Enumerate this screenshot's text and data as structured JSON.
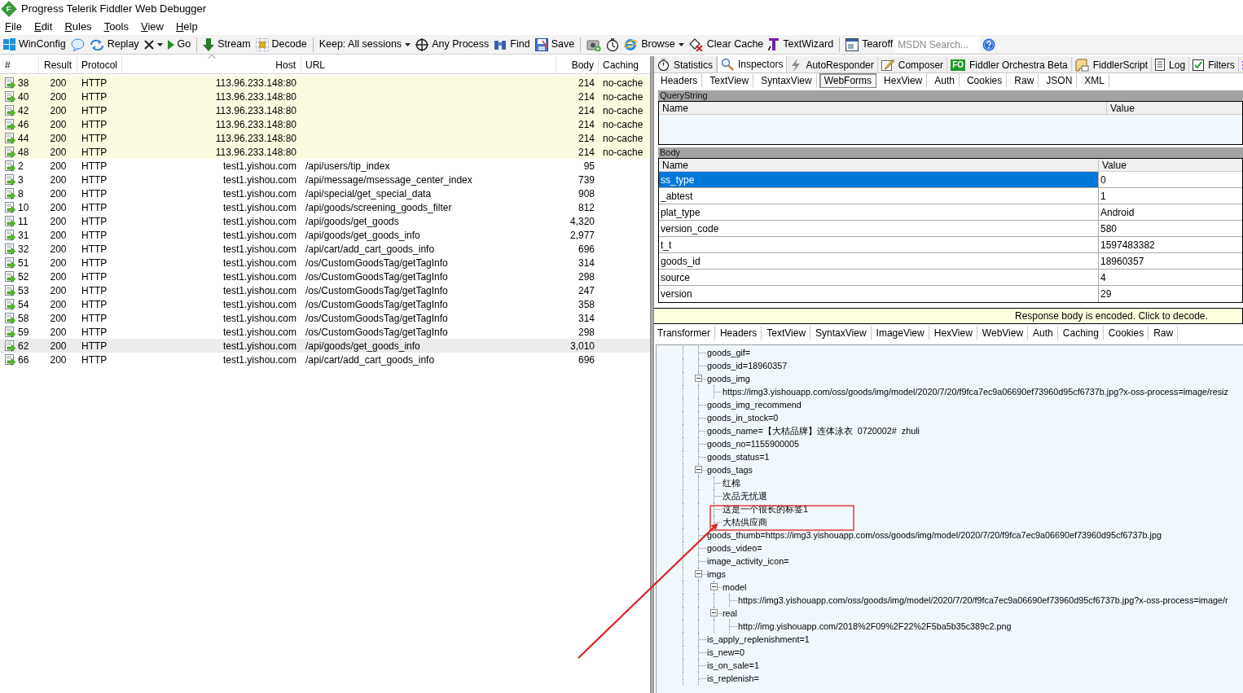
{
  "window": {
    "logo_text": "F",
    "title": "Progress Telerik Fiddler Web Debugger"
  },
  "menu": [
    "File",
    "Edit",
    "Rules",
    "Tools",
    "View",
    "Help"
  ],
  "toolbar": [
    {
      "kind": "button",
      "label": "WinConfig"
    },
    {
      "kind": "button"
    },
    {
      "kind": "button",
      "label": "Replay"
    },
    {
      "kind": "button",
      "dropdown": true
    },
    {
      "kind": "button",
      "label": "Go"
    },
    {
      "kind": "separator"
    },
    {
      "kind": "button",
      "label": "Stream"
    },
    {
      "kind": "button",
      "label": "Decode"
    },
    {
      "kind": "separator"
    },
    {
      "kind": "button",
      "label": "Keep: All sessions",
      "dropdown": true
    },
    {
      "kind": "button",
      "label": "Any Process"
    },
    {
      "kind": "button",
      "label": "Find"
    },
    {
      "kind": "button",
      "label": "Save"
    },
    {
      "kind": "separator"
    },
    {
      "kind": "button"
    },
    {
      "kind": "button"
    },
    {
      "kind": "button",
      "label": "Browse",
      "dropdown": true
    },
    {
      "kind": "button",
      "label": "Clear Cache"
    },
    {
      "kind": "button",
      "label": "TextWizard"
    },
    {
      "kind": "separator"
    },
    {
      "kind": "button",
      "label": "Tearoff"
    },
    {
      "kind": "search",
      "placeholder": "MSDN Search..."
    },
    {
      "kind": "button"
    }
  ],
  "sessions": {
    "columns": [
      {
        "label": "#",
        "sorted": false
      },
      {
        "label": "Result",
        "sorted": false
      },
      {
        "label": "Protocol",
        "sorted": false
      },
      {
        "label": "Host",
        "sorted": true
      },
      {
        "label": "URL",
        "sorted": false
      },
      {
        "label": "Body",
        "sorted": false
      },
      {
        "label": "Caching",
        "sorted": false
      }
    ],
    "rows": [
      {
        "id": "38",
        "result": "200",
        "protocol": "HTTP",
        "host": "113.96.233.148:80",
        "body": "214",
        "caching": "no-cache",
        "kind": "tunnel",
        "selected": false
      },
      {
        "id": "40",
        "result": "200",
        "protocol": "HTTP",
        "host": "113.96.233.148:80",
        "body": "214",
        "caching": "no-cache",
        "kind": "tunnel",
        "selected": false
      },
      {
        "id": "42",
        "result": "200",
        "protocol": "HTTP",
        "host": "113.96.233.148:80",
        "body": "214",
        "caching": "no-cache",
        "kind": "tunnel",
        "selected": false
      },
      {
        "id": "46",
        "result": "200",
        "protocol": "HTTP",
        "host": "113.96.233.148:80",
        "body": "214",
        "caching": "no-cache",
        "kind": "tunnel",
        "selected": false
      },
      {
        "id": "44",
        "result": "200",
        "protocol": "HTTP",
        "host": "113.96.233.148:80",
        "body": "214",
        "caching": "no-cache",
        "kind": "tunnel",
        "selected": false
      },
      {
        "id": "48",
        "result": "200",
        "protocol": "HTTP",
        "host": "113.96.233.148:80",
        "body": "214",
        "caching": "no-cache",
        "kind": "tunnel",
        "selected": false
      },
      {
        "id": "2",
        "result": "200",
        "protocol": "HTTP",
        "host": "test1.yishou.com",
        "url": "/api/users/tip_index",
        "body": "95",
        "kind": "request",
        "selected": false
      },
      {
        "id": "3",
        "result": "200",
        "protocol": "HTTP",
        "host": "test1.yishou.com",
        "url": "/api/message/msessage_center_index",
        "body": "739",
        "kind": "request",
        "selected": false
      },
      {
        "id": "8",
        "result": "200",
        "protocol": "HTTP",
        "host": "test1.yishou.com",
        "url": "/api/special/get_special_data",
        "body": "908",
        "kind": "request",
        "selected": false
      },
      {
        "id": "10",
        "result": "200",
        "protocol": "HTTP",
        "host": "test1.yishou.com",
        "url": "/api/goods/screening_goods_filter",
        "body": "812",
        "kind": "request",
        "selected": false
      },
      {
        "id": "11",
        "result": "200",
        "protocol": "HTTP",
        "host": "test1.yishou.com",
        "url": "/api/goods/get_goods",
        "body": "4,320",
        "kind": "request",
        "selected": false
      },
      {
        "id": "31",
        "result": "200",
        "protocol": "HTTP",
        "host": "test1.yishou.com",
        "url": "/api/goods/get_goods_info",
        "body": "2,977",
        "kind": "request",
        "selected": false
      },
      {
        "id": "32",
        "result": "200",
        "protocol": "HTTP",
        "host": "test1.yishou.com",
        "url": "/api/cart/add_cart_goods_info",
        "body": "696",
        "kind": "request",
        "selected": false
      },
      {
        "id": "51",
        "result": "200",
        "protocol": "HTTP",
        "host": "test1.yishou.com",
        "url": "/os/CustomGoodsTag/getTagInfo",
        "body": "314",
        "kind": "request",
        "selected": false
      },
      {
        "id": "52",
        "result": "200",
        "protocol": "HTTP",
        "host": "test1.yishou.com",
        "url": "/os/CustomGoodsTag/getTagInfo",
        "body": "298",
        "kind": "request",
        "selected": false
      },
      {
        "id": "53",
        "result": "200",
        "protocol": "HTTP",
        "host": "test1.yishou.com",
        "url": "/os/CustomGoodsTag/getTagInfo",
        "body": "247",
        "kind": "request",
        "selected": false
      },
      {
        "id": "54",
        "result": "200",
        "protocol": "HTTP",
        "host": "test1.yishou.com",
        "url": "/os/CustomGoodsTag/getTagInfo",
        "body": "358",
        "kind": "request",
        "selected": false
      },
      {
        "id": "58",
        "result": "200",
        "protocol": "HTTP",
        "host": "test1.yishou.com",
        "url": "/os/CustomGoodsTag/getTagInfo",
        "body": "314",
        "kind": "request",
        "selected": false
      },
      {
        "id": "59",
        "result": "200",
        "protocol": "HTTP",
        "host": "test1.yishou.com",
        "url": "/os/CustomGoodsTag/getTagInfo",
        "body": "298",
        "kind": "request",
        "selected": false
      },
      {
        "id": "62",
        "result": "200",
        "protocol": "HTTP",
        "host": "test1.yishou.com",
        "url": "/api/goods/get_goods_info",
        "body": "3,010",
        "kind": "request",
        "selected": true
      },
      {
        "id": "66",
        "result": "200",
        "protocol": "HTTP",
        "host": "test1.yishou.com",
        "url": "/api/cart/add_cart_goods_info",
        "body": "696",
        "kind": "request",
        "selected": false
      }
    ]
  },
  "inspector_tabs": [
    {
      "label": "Statistics",
      "selected": false
    },
    {
      "label": "Inspectors",
      "selected": true
    },
    {
      "label": "AutoResponder",
      "selected": false
    },
    {
      "label": "Composer",
      "selected": false
    },
    {
      "label": "Fiddler Orchestra Beta",
      "badge": "FO",
      "selected": false
    },
    {
      "label": "FiddlerScript",
      "selected": false
    },
    {
      "label": "Log",
      "selected": false
    },
    {
      "label": "Filters",
      "selected": false
    },
    {
      "selected": false
    }
  ],
  "request": {
    "tabs": [
      {
        "label": "Headers",
        "selected": false
      },
      {
        "label": "TextView",
        "selected": false
      },
      {
        "label": "SyntaxView",
        "selected": false
      },
      {
        "label": "WebForms",
        "selected": true
      },
      {
        "label": "HexView",
        "selected": false
      },
      {
        "label": "Auth",
        "selected": false
      },
      {
        "label": "Cookies",
        "selected": false
      },
      {
        "label": "Raw",
        "selected": false
      },
      {
        "label": "JSON",
        "selected": false
      },
      {
        "label": "XML",
        "selected": false
      }
    ],
    "querystring": {
      "title": "QueryString",
      "columns": [
        "Name",
        "Value"
      ]
    },
    "body": {
      "title": "Body",
      "columns": [
        "Name",
        "Value"
      ],
      "rows": [
        {
          "name": "ss_type",
          "value": "0",
          "selected": true
        },
        {
          "name": "_abtest",
          "value": "1",
          "selected": false
        },
        {
          "name": "plat_type",
          "value": "Android",
          "selected": false
        },
        {
          "name": "version_code",
          "value": "580",
          "selected": false
        },
        {
          "name": "t_t",
          "value": "1597483382",
          "selected": false
        },
        {
          "name": "goods_id",
          "value": "18960357",
          "selected": false
        },
        {
          "name": "source",
          "value": "4",
          "selected": false
        },
        {
          "name": "version",
          "value": "29",
          "selected": false
        }
      ]
    }
  },
  "response": {
    "notice": "Response body is encoded. Click to decode.",
    "tabs": [
      {
        "label": "Transformer",
        "selected": false
      },
      {
        "label": "Headers",
        "selected": false
      },
      {
        "label": "TextView",
        "selected": false
      },
      {
        "label": "SyntaxView",
        "selected": false
      },
      {
        "label": "ImageView",
        "selected": false
      },
      {
        "label": "HexView",
        "selected": false
      },
      {
        "label": "WebView",
        "selected": false
      },
      {
        "label": "Auth",
        "selected": false
      },
      {
        "label": "Caching",
        "selected": false
      },
      {
        "label": "Cookies",
        "selected": false
      },
      {
        "label": "Raw",
        "selected": false
      }
    ],
    "tree": [
      {
        "label": "goods_gif="
      },
      {
        "label": "goods_id=18960357"
      },
      {
        "label": "goods_img",
        "expanded": true,
        "children": [
          {
            "label": "https://img3.yishouapp.com/oss/goods/img/model/2020/7/20/f9fca7ec9a06690ef73960d95cf6737b.jpg?x-oss-process=image/resiz"
          }
        ]
      },
      {
        "label": "goods_img_recommend"
      },
      {
        "label": "goods_in_stock=0"
      },
      {
        "label": "goods_name=【大桔品牌】连体泳衣  0720002#  zhuli"
      },
      {
        "label": "goods_no=1155900005"
      },
      {
        "label": "goods_status=1"
      },
      {
        "label": "goods_tags",
        "expanded": true,
        "children": [
          {
            "label": "红棉"
          },
          {
            "label": "次品无忧退"
          },
          {
            "label": "这是一个很长的标签1"
          },
          {
            "label": "大桔供应商"
          }
        ]
      },
      {
        "label": "goods_thumb=https://img3.yishouapp.com/oss/goods/img/model/2020/7/20/f9fca7ec9a06690ef73960d95cf6737b.jpg"
      },
      {
        "label": "goods_video="
      },
      {
        "label": "image_activity_icon="
      },
      {
        "label": "imgs",
        "expanded": true,
        "children": [
          {
            "label": "model",
            "expanded": true,
            "children": [
              {
                "label": "https://img3.yishouapp.com/oss/goods/img/model/2020/7/20/f9fca7ec9a06690ef73960d95cf6737b.jpg?x-oss-process=image/r"
              }
            ]
          },
          {
            "label": "real",
            "expanded": true,
            "children": [
              {
                "label": "http://img.yishouapp.com/2018%2F09%2F22%2F5ba5b35c389c2.png"
              }
            ]
          }
        ]
      },
      {
        "label": "is_apply_replenishment=1"
      },
      {
        "label": "is_new=0"
      },
      {
        "label": "is_on_sale=1"
      },
      {
        "label": "is_replenish="
      }
    ]
  }
}
